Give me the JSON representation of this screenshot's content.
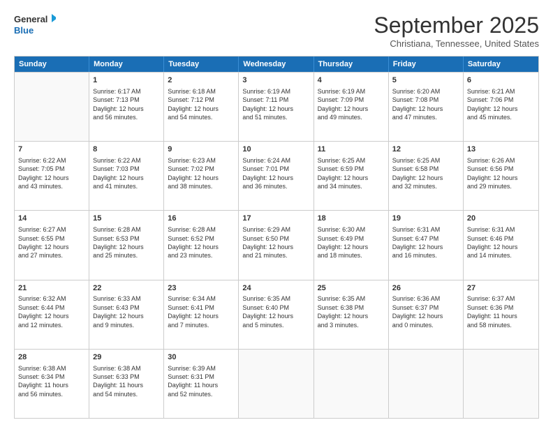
{
  "logo": {
    "line1": "General",
    "line2": "Blue"
  },
  "title": "September 2025",
  "subtitle": "Christiana, Tennessee, United States",
  "days": [
    "Sunday",
    "Monday",
    "Tuesday",
    "Wednesday",
    "Thursday",
    "Friday",
    "Saturday"
  ],
  "weeks": [
    [
      {
        "day": "",
        "info": ""
      },
      {
        "day": "1",
        "info": "Sunrise: 6:17 AM\nSunset: 7:13 PM\nDaylight: 12 hours\nand 56 minutes."
      },
      {
        "day": "2",
        "info": "Sunrise: 6:18 AM\nSunset: 7:12 PM\nDaylight: 12 hours\nand 54 minutes."
      },
      {
        "day": "3",
        "info": "Sunrise: 6:19 AM\nSunset: 7:11 PM\nDaylight: 12 hours\nand 51 minutes."
      },
      {
        "day": "4",
        "info": "Sunrise: 6:19 AM\nSunset: 7:09 PM\nDaylight: 12 hours\nand 49 minutes."
      },
      {
        "day": "5",
        "info": "Sunrise: 6:20 AM\nSunset: 7:08 PM\nDaylight: 12 hours\nand 47 minutes."
      },
      {
        "day": "6",
        "info": "Sunrise: 6:21 AM\nSunset: 7:06 PM\nDaylight: 12 hours\nand 45 minutes."
      }
    ],
    [
      {
        "day": "7",
        "info": "Sunrise: 6:22 AM\nSunset: 7:05 PM\nDaylight: 12 hours\nand 43 minutes."
      },
      {
        "day": "8",
        "info": "Sunrise: 6:22 AM\nSunset: 7:03 PM\nDaylight: 12 hours\nand 41 minutes."
      },
      {
        "day": "9",
        "info": "Sunrise: 6:23 AM\nSunset: 7:02 PM\nDaylight: 12 hours\nand 38 minutes."
      },
      {
        "day": "10",
        "info": "Sunrise: 6:24 AM\nSunset: 7:01 PM\nDaylight: 12 hours\nand 36 minutes."
      },
      {
        "day": "11",
        "info": "Sunrise: 6:25 AM\nSunset: 6:59 PM\nDaylight: 12 hours\nand 34 minutes."
      },
      {
        "day": "12",
        "info": "Sunrise: 6:25 AM\nSunset: 6:58 PM\nDaylight: 12 hours\nand 32 minutes."
      },
      {
        "day": "13",
        "info": "Sunrise: 6:26 AM\nSunset: 6:56 PM\nDaylight: 12 hours\nand 29 minutes."
      }
    ],
    [
      {
        "day": "14",
        "info": "Sunrise: 6:27 AM\nSunset: 6:55 PM\nDaylight: 12 hours\nand 27 minutes."
      },
      {
        "day": "15",
        "info": "Sunrise: 6:28 AM\nSunset: 6:53 PM\nDaylight: 12 hours\nand 25 minutes."
      },
      {
        "day": "16",
        "info": "Sunrise: 6:28 AM\nSunset: 6:52 PM\nDaylight: 12 hours\nand 23 minutes."
      },
      {
        "day": "17",
        "info": "Sunrise: 6:29 AM\nSunset: 6:50 PM\nDaylight: 12 hours\nand 21 minutes."
      },
      {
        "day": "18",
        "info": "Sunrise: 6:30 AM\nSunset: 6:49 PM\nDaylight: 12 hours\nand 18 minutes."
      },
      {
        "day": "19",
        "info": "Sunrise: 6:31 AM\nSunset: 6:47 PM\nDaylight: 12 hours\nand 16 minutes."
      },
      {
        "day": "20",
        "info": "Sunrise: 6:31 AM\nSunset: 6:46 PM\nDaylight: 12 hours\nand 14 minutes."
      }
    ],
    [
      {
        "day": "21",
        "info": "Sunrise: 6:32 AM\nSunset: 6:44 PM\nDaylight: 12 hours\nand 12 minutes."
      },
      {
        "day": "22",
        "info": "Sunrise: 6:33 AM\nSunset: 6:43 PM\nDaylight: 12 hours\nand 9 minutes."
      },
      {
        "day": "23",
        "info": "Sunrise: 6:34 AM\nSunset: 6:41 PM\nDaylight: 12 hours\nand 7 minutes."
      },
      {
        "day": "24",
        "info": "Sunrise: 6:35 AM\nSunset: 6:40 PM\nDaylight: 12 hours\nand 5 minutes."
      },
      {
        "day": "25",
        "info": "Sunrise: 6:35 AM\nSunset: 6:38 PM\nDaylight: 12 hours\nand 3 minutes."
      },
      {
        "day": "26",
        "info": "Sunrise: 6:36 AM\nSunset: 6:37 PM\nDaylight: 12 hours\nand 0 minutes."
      },
      {
        "day": "27",
        "info": "Sunrise: 6:37 AM\nSunset: 6:36 PM\nDaylight: 11 hours\nand 58 minutes."
      }
    ],
    [
      {
        "day": "28",
        "info": "Sunrise: 6:38 AM\nSunset: 6:34 PM\nDaylight: 11 hours\nand 56 minutes."
      },
      {
        "day": "29",
        "info": "Sunrise: 6:38 AM\nSunset: 6:33 PM\nDaylight: 11 hours\nand 54 minutes."
      },
      {
        "day": "30",
        "info": "Sunrise: 6:39 AM\nSunset: 6:31 PM\nDaylight: 11 hours\nand 52 minutes."
      },
      {
        "day": "",
        "info": ""
      },
      {
        "day": "",
        "info": ""
      },
      {
        "day": "",
        "info": ""
      },
      {
        "day": "",
        "info": ""
      }
    ]
  ]
}
